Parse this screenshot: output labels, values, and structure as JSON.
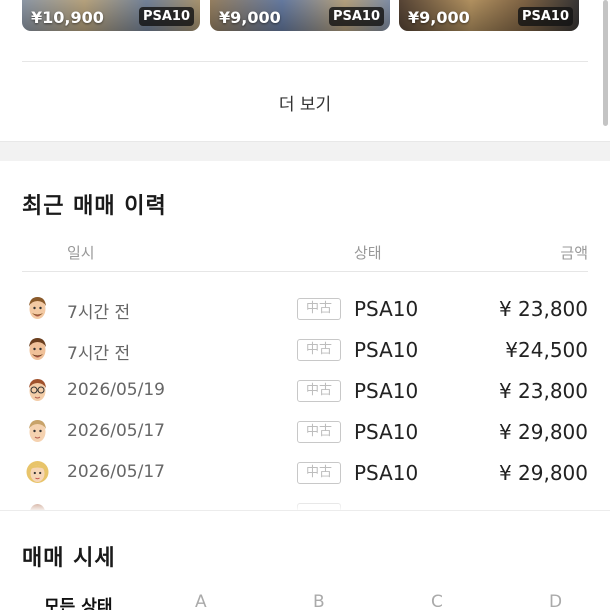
{
  "products": [
    {
      "price": "¥10,900",
      "grade": "PSA10"
    },
    {
      "price": "¥9,000",
      "grade": "PSA10"
    },
    {
      "price": "¥9,000",
      "grade": "PSA10"
    }
  ],
  "more_button": "더 보기",
  "recent": {
    "title": "최근 매매 이력",
    "headers": {
      "date": "일시",
      "status": "상태",
      "amount": "금액"
    },
    "rows": [
      {
        "avatar": "man-avatar-icon",
        "date": "7시간 전",
        "badge": "中古",
        "grade": "PSA10",
        "amount": "¥ 23,800"
      },
      {
        "avatar": "man-avatar-icon",
        "date": "7시간 전",
        "badge": "中古",
        "grade": "PSA10",
        "amount": "¥24,500"
      },
      {
        "avatar": "man-glasses-avatar-icon",
        "date": "2026/05/19",
        "badge": "中古",
        "grade": "PSA10",
        "amount": "¥ 23,800"
      },
      {
        "avatar": "man-avatar-icon",
        "date": "2026/05/17",
        "badge": "中古",
        "grade": "PSA10",
        "amount": "¥ 29,800"
      },
      {
        "avatar": "woman-avatar-icon",
        "date": "2026/05/17",
        "badge": "中古",
        "grade": "PSA10",
        "amount": "¥ 29,800"
      }
    ]
  },
  "market": {
    "title": "매매 시세",
    "filters": [
      "모든 상태",
      "A",
      "B",
      "C",
      "D"
    ]
  },
  "colors": {
    "accent_text": "#222222",
    "muted_text": "#999999",
    "badge_border": "#c8c8c8"
  }
}
